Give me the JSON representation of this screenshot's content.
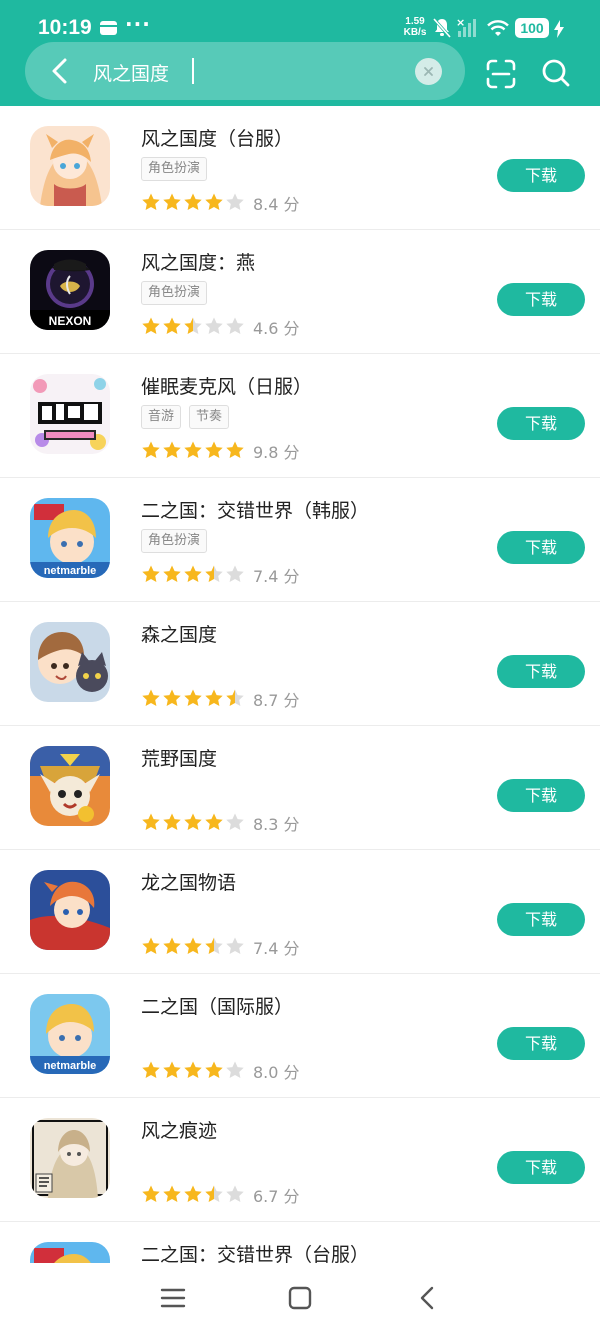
{
  "status_bar": {
    "time": "10:19",
    "dots": "···",
    "speed_value": "1.59",
    "speed_unit": "KB/s",
    "battery": "100",
    "icons": [
      "calendar-icon",
      "mute-icon",
      "signal-icon",
      "wifi-icon",
      "charging-icon"
    ]
  },
  "search": {
    "query": "风之国度",
    "icons": [
      "back-icon",
      "clear-icon",
      "scan-icon",
      "search-icon"
    ]
  },
  "colors": {
    "accent": "#1fb9a0",
    "star_filled": "#f7b71d",
    "star_empty": "#dcdcdc"
  },
  "download_label": "下载",
  "apps": [
    {
      "title": "风之国度（台服）",
      "tags": [
        "角色扮演"
      ],
      "rating_text": "8.4 分",
      "stars": 4
    },
    {
      "title": "风之国度：燕",
      "tags": [
        "角色扮演"
      ],
      "rating_text": "4.6 分",
      "stars": 2.5
    },
    {
      "title": "催眠麦克风（日服）",
      "tags": [
        "音游",
        "节奏"
      ],
      "rating_text": "9.8 分",
      "stars": 5
    },
    {
      "title": "二之国：交错世界（韩服）",
      "tags": [
        "角色扮演"
      ],
      "rating_text": "7.4 分",
      "stars": 3.5
    },
    {
      "title": "森之国度",
      "tags": [],
      "rating_text": "8.7 分",
      "stars": 4.5
    },
    {
      "title": "荒野国度",
      "tags": [],
      "rating_text": "8.3 分",
      "stars": 4
    },
    {
      "title": "龙之国物语",
      "tags": [],
      "rating_text": "7.4 分",
      "stars": 3.5
    },
    {
      "title": "二之国（国际服）",
      "tags": [],
      "rating_text": "8.0 分",
      "stars": 4
    },
    {
      "title": "风之痕迹",
      "tags": [],
      "rating_text": "6.7 分",
      "stars": 3.5
    },
    {
      "title": "二之国：交错世界（台服）",
      "tags": [],
      "rating_text": "",
      "stars": 0
    }
  ],
  "app_icon_texts": [
    "NEXON",
    "netmarble",
    "netmarble"
  ],
  "nav_bar": {
    "icons": [
      "menu-icon",
      "home-icon",
      "back-nav-icon"
    ]
  }
}
